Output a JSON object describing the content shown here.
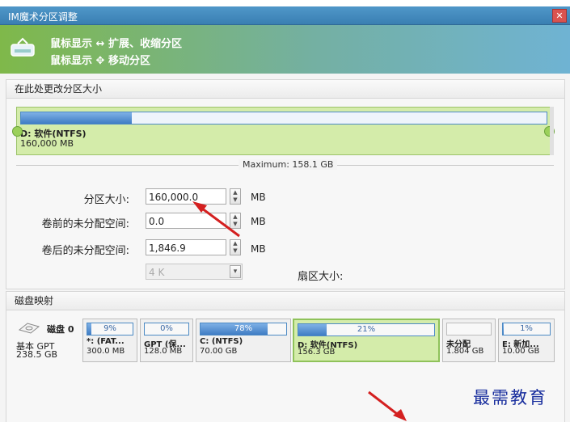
{
  "window": {
    "title": "IM魔术分区调整",
    "close_icon": "close-icon"
  },
  "banner": {
    "line1": "鼠标显示 ↔ 扩展、收缩分区",
    "line2": "鼠标显示 ✥ 移动分区"
  },
  "resize": {
    "header": "在此处更改分区大小",
    "partition_name": "D: 软件(NTFS)",
    "partition_size": "160,000 MB",
    "partition_fill_fraction": 0.21,
    "maximum": "Maximum: 158.1 GB"
  },
  "form": {
    "size_label": "分区大小:",
    "size_value": "160,000.0",
    "size_unit": "MB",
    "before_label": "卷前的未分配空间:",
    "before_value": "0.0",
    "before_unit": "MB",
    "after_label": "卷后的未分配空间:",
    "after_value": "1,846.9",
    "after_unit": "MB",
    "cluster_value": "4 K",
    "sector_label": "扇区大小:"
  },
  "diskmap": {
    "header": "磁盘映射",
    "disk_label": "磁盘 0",
    "disk_type": "基本 GPT",
    "disk_size": "238.5 GB",
    "partitions": [
      {
        "pct": "9%",
        "fill": 0.09,
        "name": "*: (FAT...",
        "size": "300.0 MB"
      },
      {
        "pct": "0%",
        "fill": 0.0,
        "name": "GPT (保...",
        "size": "128.0 MB"
      },
      {
        "pct": "78%",
        "fill": 0.78,
        "name": "C: (NTFS)",
        "size": "70.00 GB"
      },
      {
        "pct": "21%",
        "fill": 0.21,
        "name": "D: 软件(NTFS)",
        "size": "156.3 GB"
      },
      {
        "pct": "",
        "fill": 0.0,
        "name": "未分配",
        "size": "1.804 GB"
      },
      {
        "pct": "1%",
        "fill": 0.01,
        "name": "E: 新加...",
        "size": "10.00 GB"
      }
    ]
  },
  "watermark": "最需教育",
  "colors": {
    "accent": "#3f7cc4",
    "selected": "#d4ecaa",
    "arrow": "#d42020"
  }
}
